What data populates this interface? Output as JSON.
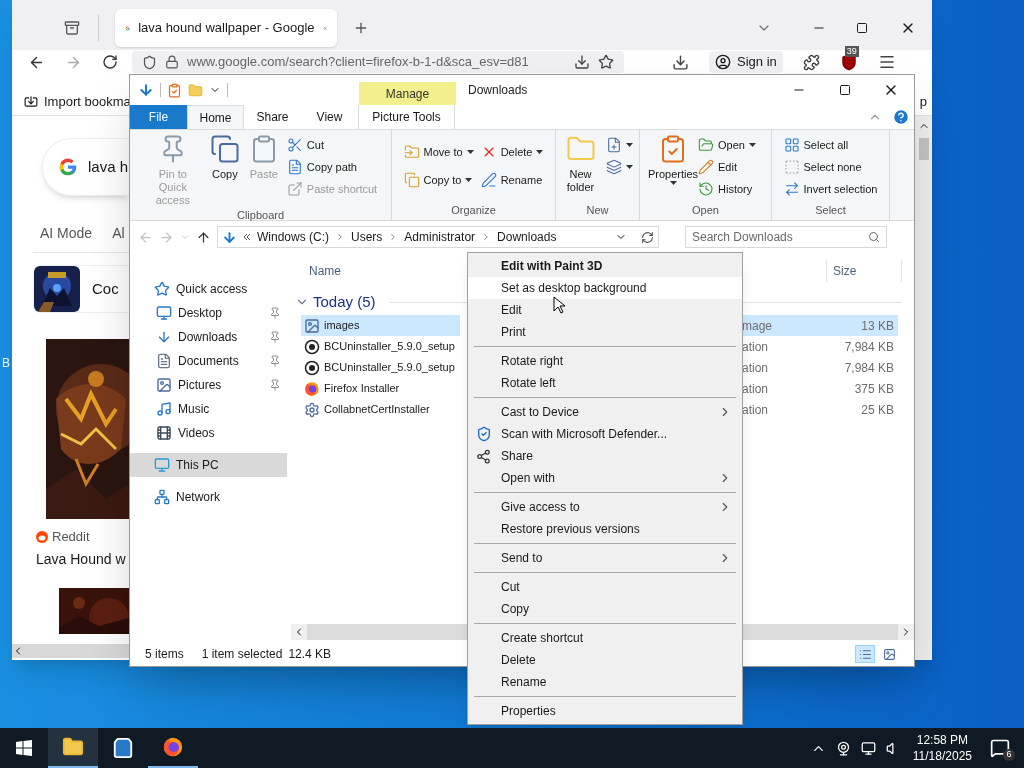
{
  "desktop": {
    "icon_label": "B"
  },
  "browser": {
    "tab_title": "lava hound wallpaper - Google",
    "url": "www.google.com/search?client=firefox-b-1-d&sca_esv=d81",
    "sign_in": "Sign in",
    "extension_badge": "39",
    "bookmarks": [
      "Import bookma",
      "p"
    ],
    "search_value": "lava h",
    "filters": [
      "AI Mode",
      "Al"
    ],
    "top_result": "Coc",
    "image_result": {
      "source": "Reddit",
      "title": "Lava Hound w"
    }
  },
  "explorer": {
    "title": "Downloads",
    "context_group": "Manage",
    "tabs": [
      {
        "label": "File",
        "kind": "file",
        "selected": false
      },
      {
        "label": "Home",
        "kind": "normal",
        "selected": true
      },
      {
        "label": "Share",
        "kind": "normal",
        "selected": false
      },
      {
        "label": "View",
        "kind": "normal",
        "selected": false
      },
      {
        "label": "Picture Tools",
        "kind": "context",
        "selected": false
      }
    ],
    "ribbon": [
      {
        "name": "Clipboard",
        "commands": [
          {
            "label": "Pin to Quick access",
            "kind": "large",
            "disabled": true,
            "dropdown": false
          },
          {
            "label": "Copy",
            "kind": "large",
            "disabled": false,
            "dropdown": false
          },
          {
            "label": "Paste",
            "kind": "large",
            "disabled": true,
            "dropdown": false
          },
          {
            "label": "Cut",
            "kind": "small",
            "disabled": false,
            "dropdown": false
          },
          {
            "label": "Copy path",
            "kind": "small",
            "disabled": false,
            "dropdown": false
          },
          {
            "label": "Paste shortcut",
            "kind": "small",
            "disabled": true,
            "dropdown": false
          }
        ]
      },
      {
        "name": "Organize",
        "commands": [
          {
            "label": "Move to",
            "kind": "small",
            "disabled": false,
            "dropdown": true
          },
          {
            "label": "Copy to",
            "kind": "small",
            "disabled": false,
            "dropdown": true
          },
          {
            "label": "Delete",
            "kind": "small",
            "disabled": false,
            "dropdown": true
          },
          {
            "label": "Rename",
            "kind": "small",
            "disabled": false,
            "dropdown": false
          }
        ]
      },
      {
        "name": "New",
        "commands": [
          {
            "label": "New folder",
            "kind": "large",
            "disabled": false,
            "dropdown": false
          },
          {
            "kind": "small",
            "disabled": false,
            "dropdown": true
          },
          {
            "kind": "small",
            "disabled": false,
            "dropdown": true
          }
        ]
      },
      {
        "name": "Open",
        "commands": [
          {
            "label": "Properties",
            "kind": "large",
            "disabled": false,
            "dropdown": true
          },
          {
            "label": "Open",
            "kind": "small",
            "disabled": false,
            "dropdown": true
          },
          {
            "label": "Edit",
            "kind": "small",
            "disabled": false,
            "dropdown": false
          },
          {
            "label": "History",
            "kind": "small",
            "disabled": false,
            "dropdown": false
          }
        ]
      },
      {
        "name": "Select",
        "commands": [
          {
            "label": "Select all",
            "kind": "small",
            "disabled": false,
            "dropdown": false
          },
          {
            "label": "Select none",
            "kind": "small",
            "disabled": false,
            "dropdown": false
          },
          {
            "label": "Invert selection",
            "kind": "small",
            "disabled": false,
            "dropdown": false
          }
        ]
      }
    ],
    "address": {
      "path": [
        "Windows (C:)",
        "Users",
        "Administrator",
        "Downloads"
      ],
      "search_placeholder": "Search Downloads"
    },
    "nav": [
      {
        "label": "Quick access",
        "kind": "quick-access",
        "selected": false,
        "children": [
          {
            "label": "Desktop",
            "kind": "desktop",
            "pinned": true,
            "selected": false
          },
          {
            "label": "Downloads",
            "kind": "downloads",
            "pinned": true,
            "selected": false
          },
          {
            "label": "Documents",
            "kind": "documents",
            "pinned": true,
            "selected": false
          },
          {
            "label": "Pictures",
            "kind": "pictures",
            "pinned": true,
            "selected": false
          },
          {
            "label": "Music",
            "kind": "music",
            "pinned": false,
            "selected": false
          },
          {
            "label": "Videos",
            "kind": "videos",
            "pinned": false,
            "selected": false
          }
        ]
      },
      {
        "label": "This PC",
        "kind": "pc",
        "selected": true
      },
      {
        "label": "Network",
        "kind": "network",
        "selected": false
      }
    ],
    "columns": [
      "Name",
      "Size"
    ],
    "group": {
      "label": "Today (5)",
      "expanded": true
    },
    "files": [
      {
        "name": "images",
        "type": "mage",
        "size": "13 KB",
        "selected": true
      },
      {
        "name": "BCUninstaller_5.9.0_setup",
        "kind": "uninstaller",
        "type": "ation",
        "size": "7,984 KB",
        "selected": false
      },
      {
        "name": "BCUninstaller_5.9.0_setup",
        "kind": "uninstaller",
        "type": "ation",
        "size": "7,984 KB",
        "selected": false
      },
      {
        "name": "Firefox Installer",
        "kind": "firefox",
        "type": "ation",
        "size": "375 KB",
        "selected": false
      },
      {
        "name": "CollabnetCertInstaller",
        "kind": "installer",
        "type": "ation",
        "size": "25 KB",
        "selected": false
      }
    ],
    "status": {
      "count": "5 items",
      "selection": "1 item selected",
      "size": "12.4 KB"
    },
    "views": [
      {
        "kind": "details",
        "selected": true
      },
      {
        "kind": "large-icons",
        "selected": false
      }
    ]
  },
  "context_menu": [
    {
      "kind": "item",
      "label": "Edit with Paint 3D",
      "default": true,
      "highlighted": false,
      "submenu": false
    },
    {
      "kind": "item",
      "label": "Set as desktop background",
      "default": false,
      "highlighted": true,
      "submenu": false
    },
    {
      "kind": "item",
      "label": "Edit",
      "default": false,
      "highlighted": false,
      "submenu": false
    },
    {
      "kind": "item",
      "label": "Print",
      "default": false,
      "highlighted": false,
      "submenu": false
    },
    {
      "kind": "separator"
    },
    {
      "kind": "item",
      "label": "Rotate right",
      "default": false,
      "highlighted": false,
      "submenu": false
    },
    {
      "kind": "item",
      "label": "Rotate left",
      "default": false,
      "highlighted": false,
      "submenu": false
    },
    {
      "kind": "separator"
    },
    {
      "kind": "item",
      "label": "Cast to Device",
      "default": false,
      "highlighted": false,
      "submenu": true
    },
    {
      "kind": "defender",
      "label": "Scan with Microsoft Defender...",
      "default": false,
      "highlighted": false,
      "submenu": false
    },
    {
      "kind": "share",
      "label": "Share",
      "default": false,
      "highlighted": false,
      "submenu": false
    },
    {
      "kind": "item",
      "label": "Open with",
      "default": false,
      "highlighted": false,
      "submenu": true
    },
    {
      "kind": "separator"
    },
    {
      "kind": "item",
      "label": "Give access to",
      "default": false,
      "highlighted": false,
      "submenu": true
    },
    {
      "kind": "item",
      "label": "Restore previous versions",
      "default": false,
      "highlighted": false,
      "submenu": false
    },
    {
      "kind": "separator"
    },
    {
      "kind": "item",
      "label": "Send to",
      "default": false,
      "highlighted": false,
      "submenu": true
    },
    {
      "kind": "separator"
    },
    {
      "kind": "item",
      "label": "Cut",
      "default": false,
      "highlighted": false,
      "submenu": false
    },
    {
      "kind": "item",
      "label": "Copy",
      "default": false,
      "highlighted": false,
      "submenu": false
    },
    {
      "kind": "separator"
    },
    {
      "kind": "item",
      "label": "Create shortcut",
      "default": false,
      "highlighted": false,
      "submenu": false
    },
    {
      "kind": "item",
      "label": "Delete",
      "default": false,
      "highlighted": false,
      "submenu": false
    },
    {
      "kind": "item",
      "label": "Rename",
      "default": false,
      "highlighted": false,
      "submenu": false
    },
    {
      "kind": "separator"
    },
    {
      "kind": "item",
      "label": "Properties",
      "default": false,
      "highlighted": false,
      "submenu": false
    }
  ],
  "taskbar": {
    "apps": [
      {
        "kind": "explorer",
        "active": true,
        "running": true
      },
      {
        "kind": "store",
        "active": false,
        "running": false
      },
      {
        "kind": "firefox",
        "active": false,
        "running": true
      }
    ],
    "time": "12:58 PM",
    "date": "11/18/2025",
    "notifications": "6"
  }
}
